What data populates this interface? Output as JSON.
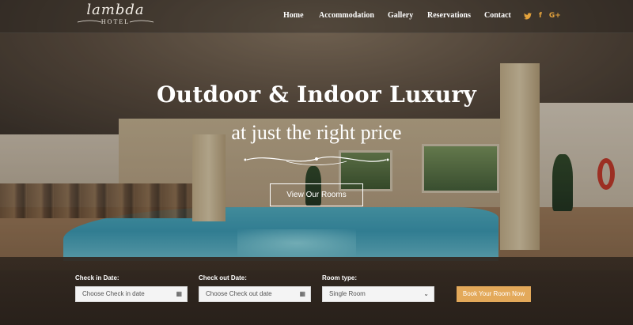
{
  "brand": {
    "logo_script": "lambda",
    "logo_sub": "HOTEL"
  },
  "nav": {
    "items": [
      {
        "label": "Home"
      },
      {
        "label": "Accommodation"
      },
      {
        "label": "Gallery"
      },
      {
        "label": "Reservations"
      },
      {
        "label": "Contact"
      }
    ],
    "social": [
      {
        "icon": "twitter-icon",
        "glyph": "🐦"
      },
      {
        "icon": "facebook-icon",
        "glyph": "f"
      },
      {
        "icon": "google-plus-icon",
        "glyph": "G+"
      }
    ]
  },
  "hero": {
    "title": "Outdoor & Indoor Luxury",
    "subtitle": "at just the right price",
    "cta_label": "View Our Rooms"
  },
  "booking": {
    "checkin_label": "Check in Date:",
    "checkin_placeholder": "Choose Check in date",
    "checkout_label": "Check out Date:",
    "checkout_placeholder": "Choose Check out date",
    "room_label": "Room type:",
    "room_selected": "Single Room",
    "book_label": "Book Your Room Now"
  },
  "colors": {
    "accent": "#e3a95a",
    "social": "#e3a23c"
  }
}
